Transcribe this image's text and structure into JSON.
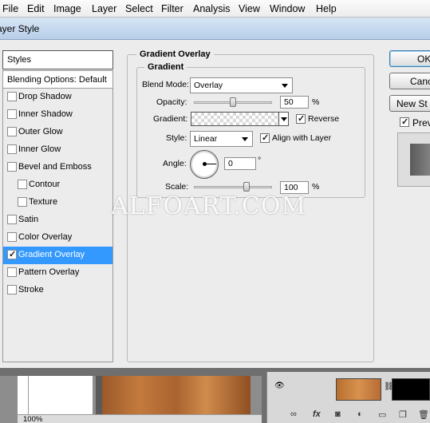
{
  "menubar": {
    "items": [
      "File",
      "Edit",
      "Image",
      "Layer",
      "Select",
      "Filter",
      "Analysis",
      "View",
      "Window",
      "Help"
    ]
  },
  "dialog": {
    "title": "Layer Style",
    "title_visible": "ayer Style"
  },
  "styles_panel": {
    "header": "Styles",
    "blending_options": "Blending Options: Default",
    "items": [
      {
        "label": "Drop Shadow",
        "checked": false,
        "indent": false,
        "has_checkbox": true
      },
      {
        "label": "Inner Shadow",
        "checked": false,
        "indent": false,
        "has_checkbox": true
      },
      {
        "label": "Outer Glow",
        "checked": false,
        "indent": false,
        "has_checkbox": true
      },
      {
        "label": "Inner Glow",
        "checked": false,
        "indent": false,
        "has_checkbox": true
      },
      {
        "label": "Bevel and Emboss",
        "checked": false,
        "indent": false,
        "has_checkbox": true
      },
      {
        "label": "Contour",
        "checked": false,
        "indent": true,
        "has_checkbox": true
      },
      {
        "label": "Texture",
        "checked": false,
        "indent": true,
        "has_checkbox": true
      },
      {
        "label": "Satin",
        "checked": false,
        "indent": false,
        "has_checkbox": true
      },
      {
        "label": "Color Overlay",
        "checked": false,
        "indent": false,
        "has_checkbox": true
      },
      {
        "label": "Gradient Overlay",
        "checked": true,
        "indent": false,
        "has_checkbox": true,
        "selected": true
      },
      {
        "label": "Pattern Overlay",
        "checked": false,
        "indent": false,
        "has_checkbox": true
      },
      {
        "label": "Stroke",
        "checked": false,
        "indent": false,
        "has_checkbox": true
      }
    ]
  },
  "gradient_overlay": {
    "section_title": "Gradient Overlay",
    "group_title": "Gradient",
    "blend_mode_label": "Blend Mode:",
    "blend_mode_value": "Overlay",
    "opacity_label": "Opacity:",
    "opacity_value": "50",
    "opacity_fraction": 0.5,
    "gradient_label": "Gradient:",
    "reverse_label": "Reverse",
    "reverse_checked": true,
    "style_label": "Style:",
    "style_value": "Linear",
    "align_label": "Align with Layer",
    "align_checked": true,
    "angle_label": "Angle:",
    "angle_value": "0",
    "angle_unit": "°",
    "scale_label": "Scale:",
    "scale_value": "100",
    "scale_fraction": 0.67,
    "percent": "%"
  },
  "buttons": {
    "ok": "OK",
    "cancel": "Canc",
    "new_style": "New St",
    "preview": "Prev",
    "preview_checked": true
  },
  "watermark": "ALFOART.COM",
  "statusbar": {
    "zoom": "100%"
  },
  "layers_panel": {
    "buttons": [
      "link-icon",
      "fx-icon",
      "mask-icon",
      "adjustment-icon",
      "folder-icon",
      "new-layer-icon",
      "trash-icon"
    ],
    "fx_label": "fx"
  }
}
